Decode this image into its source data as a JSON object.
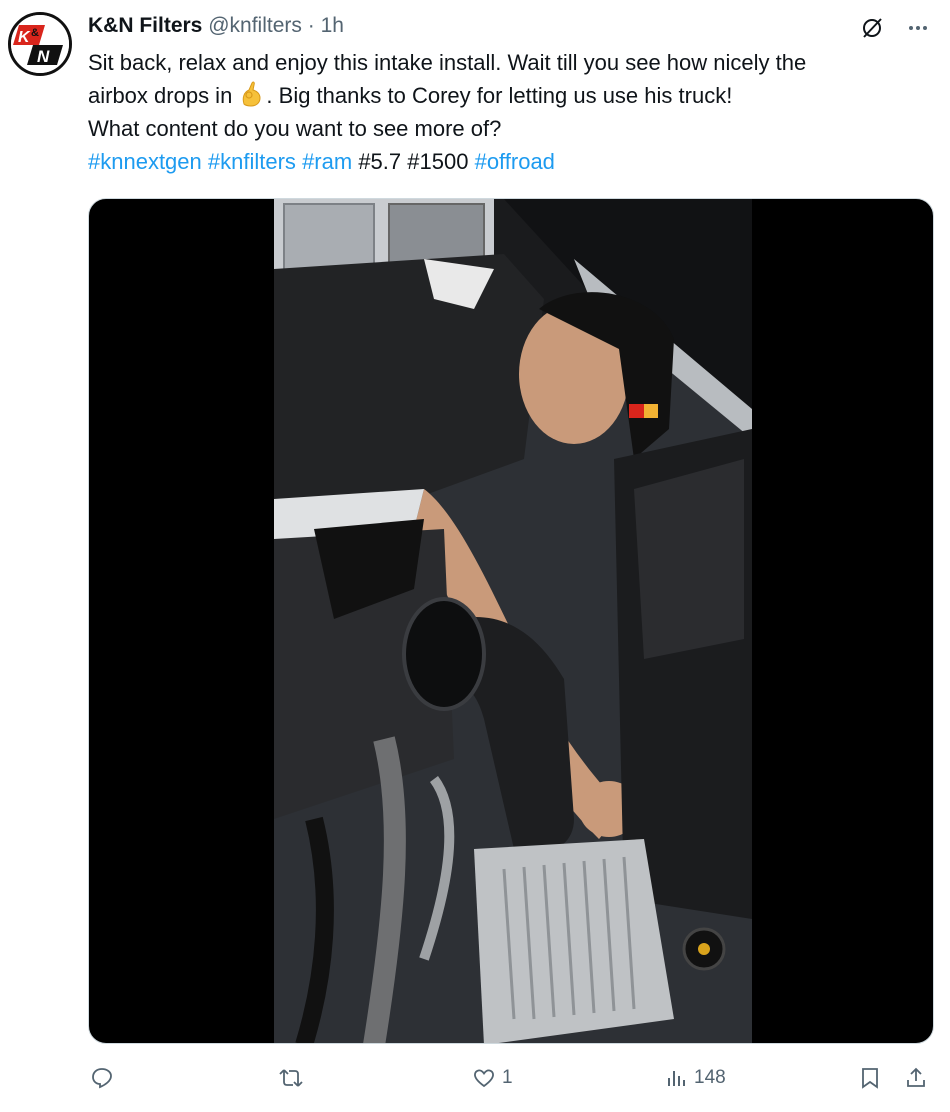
{
  "author": {
    "name": "K&N Filters",
    "handle": "@knfilters",
    "separator": "·",
    "time": "1h",
    "avatar_icon": "kn-logo-icon",
    "avatar_text": "K&N"
  },
  "tweet": {
    "line1": "Sit back, relax and enjoy this intake install. Wait till you see how nicely the",
    "line2_before": "airbox drops in ",
    "line2_emoji": "ok-hand-emoji",
    "line2_after": ". Big thanks to Corey for letting us use his truck!",
    "line3": "What content do you want to see more of?",
    "hashtags": [
      "#knnextgen",
      "#knfilters",
      "#ram",
      "#5.7",
      "#1500",
      "#offroad"
    ]
  },
  "media": {
    "type": "video",
    "description_icon": "video-frame"
  },
  "actions": {
    "reply_count": "",
    "retweet_count": "",
    "like_count": "1",
    "view_count": "148"
  },
  "colors": {
    "link": "#1d9bf0",
    "text": "#0f1419",
    "muted": "#536471"
  }
}
